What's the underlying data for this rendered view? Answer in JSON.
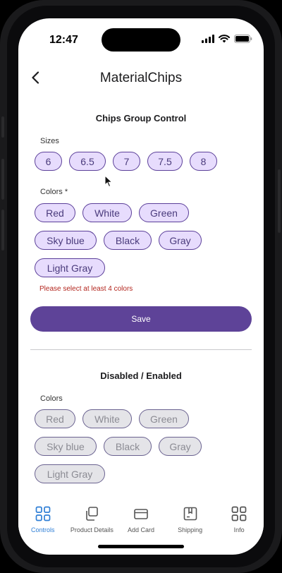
{
  "status_bar": {
    "time": "12:47"
  },
  "header": {
    "title": "MaterialChips",
    "back_icon": "chevron-left-icon"
  },
  "chips_group": {
    "title": "Chips Group Control",
    "sizes_label": "Sizes",
    "sizes": [
      "6",
      "6.5",
      "7",
      "7.5",
      "8"
    ],
    "colors_label": "Colors *",
    "colors": [
      "Red",
      "White",
      "Green",
      "Sky blue",
      "Black",
      "Gray",
      "Light Gray"
    ],
    "error": "Please select at least 4 colors",
    "save_label": "Save"
  },
  "disabled_group": {
    "title": "Disabled / Enabled",
    "colors_label": "Colors",
    "colors": [
      "Red",
      "White",
      "Green",
      "Sky blue",
      "Black",
      "Gray",
      "Light Gray"
    ]
  },
  "tab_bar": {
    "tabs": [
      {
        "label": "Controls",
        "icon": "grid-icon",
        "active": true
      },
      {
        "label": "Product Details",
        "icon": "copy-icon",
        "active": false
      },
      {
        "label": "Add Card",
        "icon": "card-icon",
        "active": false
      },
      {
        "label": "Shipping",
        "icon": "package-icon",
        "active": false
      },
      {
        "label": "Info",
        "icon": "grid-icon",
        "active": false
      }
    ]
  },
  "colors": {
    "accent": "#5e4398",
    "chip_bg": "#e7dcfd",
    "chip_border": "#5b3f99",
    "error": "#b3261e",
    "active_tab": "#2f7fd6"
  }
}
